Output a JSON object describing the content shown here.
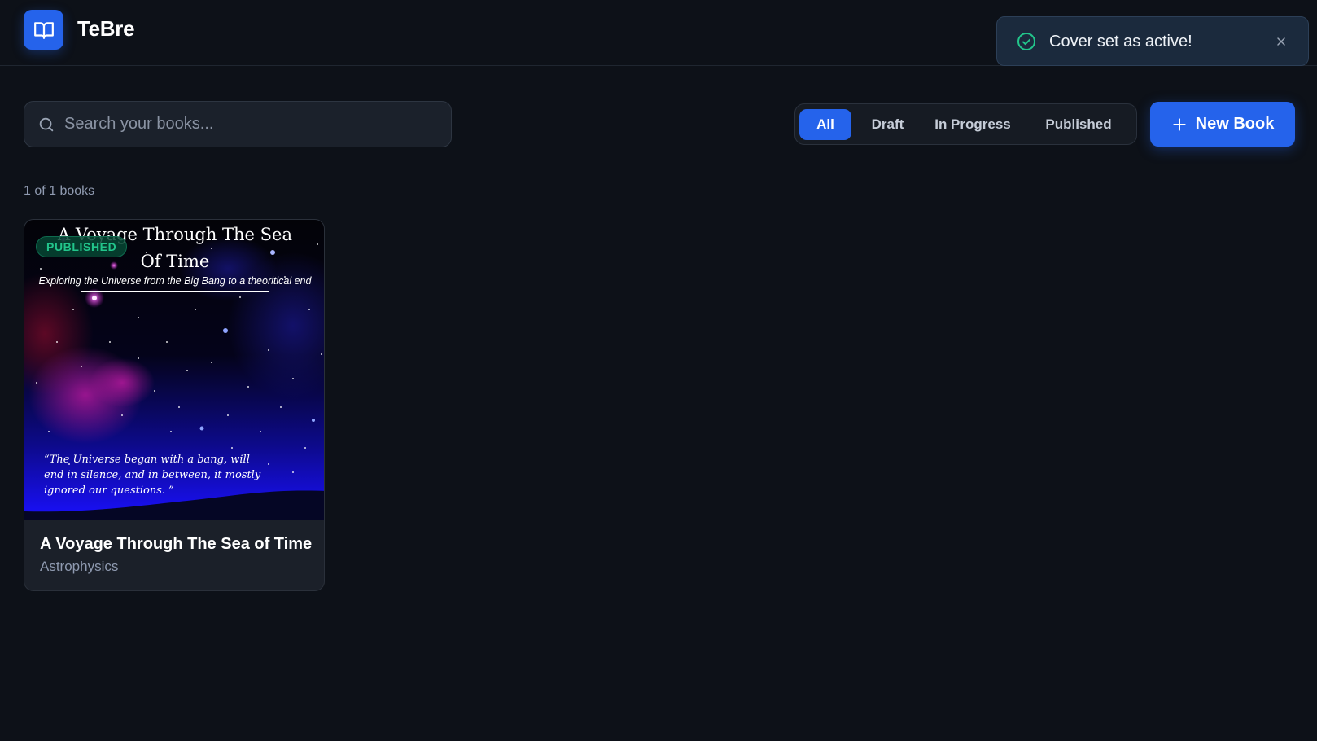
{
  "app": {
    "title": "TeBre",
    "logo_icon": "open-book-icon",
    "accent": "#2563eb"
  },
  "toast": {
    "message": "Cover set as active!",
    "icon": "check-circle-icon",
    "close_icon": "close-icon",
    "color": "#22c58b"
  },
  "search": {
    "placeholder": "Search your books...",
    "value": "",
    "icon": "search-icon"
  },
  "filters": {
    "tabs": [
      {
        "label": "All",
        "active": true
      },
      {
        "label": "Draft",
        "active": false
      },
      {
        "label": "In Progress",
        "active": false
      },
      {
        "label": "Published",
        "active": false
      }
    ]
  },
  "new_book": {
    "label": "New Book",
    "icon": "plus-icon"
  },
  "library": {
    "count_text": "1 of 1 books",
    "books": [
      {
        "status": "PUBLISHED",
        "title": "A Voyage Through The Sea of Time",
        "genre": "Astrophysics",
        "cover": {
          "title_line1": "A Voyage Through The Sea",
          "title_line2": "Of Time",
          "subtitle": "Exploring the Universe from the Big Bang to a theoritical end",
          "quote": "“The Universe began with a bang, will end in silence, and in between, it mostly ignored our questions. ”"
        }
      }
    ]
  }
}
